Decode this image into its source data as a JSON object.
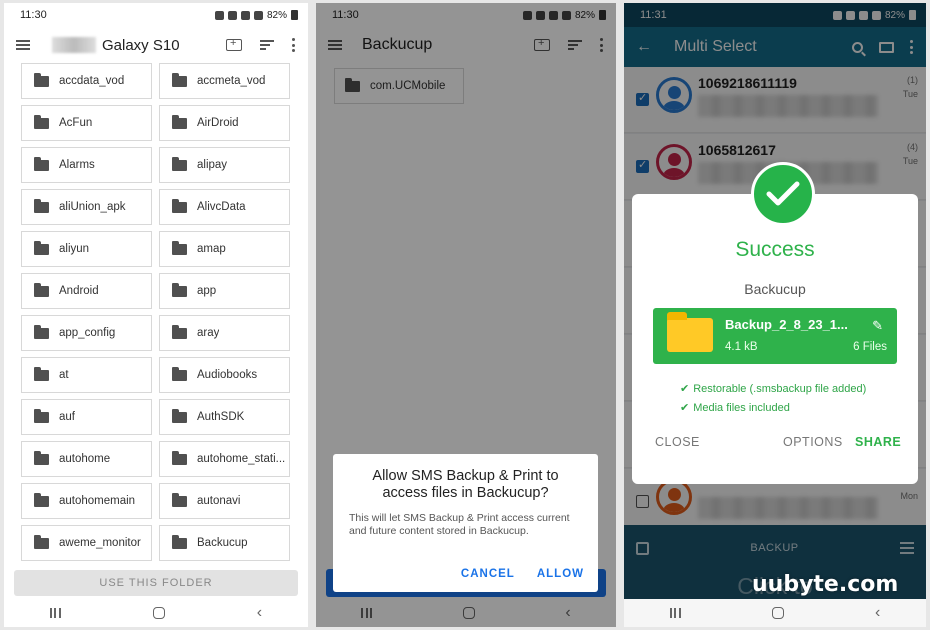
{
  "panel1": {
    "time": "11:30",
    "battery": "82%",
    "title": "Galaxy S10",
    "folders": [
      "accdata_vod",
      "accmeta_vod",
      "AcFun",
      "AirDroid",
      "Alarms",
      "alipay",
      "aliUnion_apk",
      "AlivcData",
      "aliyun",
      "amap",
      "Android",
      "app",
      "app_config",
      "aray",
      "at",
      "Audiobooks",
      "auf",
      "AuthSDK",
      "autohome",
      "autohome_stati...",
      "autohomemain",
      "autonavi",
      "aweme_monitor",
      "Backucup"
    ],
    "use_folder_label": "USE THIS FOLDER"
  },
  "panel2": {
    "time": "11:30",
    "battery": "82%",
    "title": "Backucup",
    "folder": "com.UCMobile",
    "dialog": {
      "title": "Allow SMS Backup & Print to access files in Backucup?",
      "body": "This will let SMS Backup & Print access current and future content stored in Backucup.",
      "cancel": "CANCEL",
      "allow": "ALLOW"
    }
  },
  "panel3": {
    "time": "11:31",
    "battery": "82%",
    "title": "Multi Select",
    "messages": [
      {
        "number": "1069218611119",
        "count": "(1)",
        "day": "Tue"
      },
      {
        "number": "1065812617",
        "count": "(4)",
        "day": "Tue"
      },
      {
        "number": "",
        "count": "",
        "day": "Mon"
      }
    ],
    "bottom_label": "BACKUP",
    "ad_text": "Click to ",
    "success": {
      "title": "Success",
      "subtitle": "Backucup",
      "file_name": "Backup_2_8_23_1...",
      "file_size": "4.1 kB",
      "file_count": "6 Files",
      "check1": "Restorable (.smsbackup file added)",
      "check2": "Media files included",
      "close": "CLOSE",
      "options": "OPTIONS",
      "share": "SHARE"
    }
  },
  "watermark": "uubyte.com",
  "colors": {
    "accent_blue": "#1a73e8",
    "success_green": "#2fb24b",
    "teal_bar": "#14708f"
  }
}
